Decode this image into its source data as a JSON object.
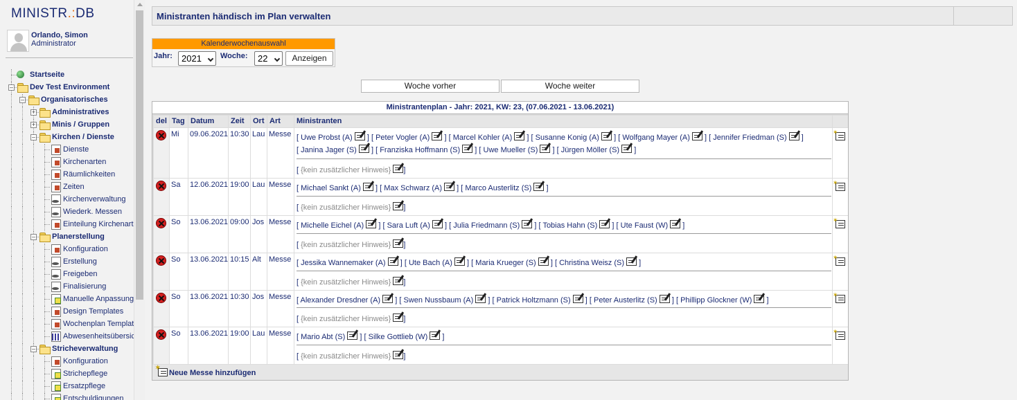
{
  "app": {
    "logo_text": "MINISTR",
    "logo_dot": ".:",
    "logo_suffix": "DB"
  },
  "user": {
    "name": "Orlando, Simon",
    "role": "Administrator"
  },
  "tree": [
    {
      "label": "Startseite",
      "level": 0,
      "icon": "globe-icon",
      "bold": true,
      "expander": ""
    },
    {
      "label": "Dev Test Environment",
      "level": 0,
      "icon": "folder-open-icon",
      "bold": true,
      "expander": "-"
    },
    {
      "label": "Organisatorisches",
      "level": 1,
      "icon": "folder-open-icon",
      "bold": true,
      "expander": "-"
    },
    {
      "label": "Administratives",
      "level": 2,
      "icon": "folder-icon",
      "bold": true,
      "expander": "+"
    },
    {
      "label": "Minis / Gruppen",
      "level": 2,
      "icon": "folder-icon",
      "bold": true,
      "expander": "+"
    },
    {
      "label": "Kirchen / Dienste",
      "level": 2,
      "icon": "folder-open-icon",
      "bold": true,
      "expander": "-"
    },
    {
      "label": "Dienste",
      "level": 3,
      "icon": "settings-page-icon",
      "bold": false,
      "expander": ""
    },
    {
      "label": "Kirchenarten",
      "level": 3,
      "icon": "settings-page-icon",
      "bold": false,
      "expander": ""
    },
    {
      "label": "Räumlichkeiten",
      "level": 3,
      "icon": "settings-page-icon",
      "bold": false,
      "expander": ""
    },
    {
      "label": "Zeiten",
      "level": 3,
      "icon": "settings-page-icon",
      "bold": false,
      "expander": ""
    },
    {
      "label": "Kirchenverwaltung",
      "level": 3,
      "icon": "church-icon",
      "bold": false,
      "expander": ""
    },
    {
      "label": "Wiederk. Messen",
      "level": 3,
      "icon": "church-icon",
      "bold": false,
      "expander": ""
    },
    {
      "label": "Einteilung Kirchenart",
      "level": 3,
      "icon": "people-icon",
      "bold": false,
      "expander": ""
    },
    {
      "label": "Planerstellung",
      "level": 2,
      "icon": "folder-open-icon",
      "bold": true,
      "expander": "-"
    },
    {
      "label": "Konfiguration",
      "level": 3,
      "icon": "settings-page-icon",
      "bold": false,
      "expander": ""
    },
    {
      "label": "Erstellung",
      "level": 3,
      "icon": "disk-icon",
      "bold": false,
      "expander": ""
    },
    {
      "label": "Freigeben",
      "level": 3,
      "icon": "disk-icon",
      "bold": false,
      "expander": ""
    },
    {
      "label": "Finalisierung",
      "level": 3,
      "icon": "disk-icon",
      "bold": false,
      "expander": ""
    },
    {
      "label": "Manuelle Anpassung",
      "level": 3,
      "icon": "edit-tree-icon",
      "bold": false,
      "expander": ""
    },
    {
      "label": "Design Templates",
      "level": 3,
      "icon": "settings-page-icon",
      "bold": false,
      "expander": ""
    },
    {
      "label": "Wochenplan Templat",
      "level": 3,
      "icon": "settings-page-icon",
      "bold": false,
      "expander": ""
    },
    {
      "label": "Abwesenheitsübersic",
      "level": 3,
      "icon": "bar-chart-icon",
      "bold": false,
      "expander": ""
    },
    {
      "label": "Stricheverwaltung",
      "level": 2,
      "icon": "folder-open-icon",
      "bold": true,
      "expander": "-"
    },
    {
      "label": "Konfiguration",
      "level": 3,
      "icon": "settings-page-icon",
      "bold": false,
      "expander": ""
    },
    {
      "label": "Strichepflege",
      "level": 3,
      "icon": "edit-tree-icon",
      "bold": false,
      "expander": ""
    },
    {
      "label": "Ersatzpflege",
      "level": 3,
      "icon": "edit-tree-icon",
      "bold": false,
      "expander": ""
    },
    {
      "label": "Entschuldigungen",
      "level": 3,
      "icon": "edit-tree-icon",
      "bold": false,
      "expander": ""
    }
  ],
  "header": {
    "title": "Ministranten händisch im Plan verwalten"
  },
  "week_select": {
    "title": "Kalenderwochenauswahl",
    "year_label": "Jahr:",
    "year_value": "2021",
    "week_label": "Woche:",
    "week_value": "22",
    "show_button": "Anzeigen"
  },
  "nav": {
    "prev": "Woche vorher",
    "next": "Woche weiter"
  },
  "plan": {
    "title": "Ministrantenplan - Jahr: 2021, KW: 23, (07.06.2021 - 13.06.2021)",
    "columns": [
      "del",
      "Tag",
      "Datum",
      "Zeit",
      "Ort",
      "Art",
      "Ministranten"
    ],
    "hint_text": "{kein zusätzlicher Hinweis}",
    "add_mass": "Neue Messe hinzufügen",
    "rows": [
      {
        "tag": "Mi",
        "datum": "09.06.2021",
        "zeit": "10:30",
        "ort": "Lau",
        "art": "Messe",
        "ministranten": [
          "Uwe Probst (A)",
          "Peter Vogler (A)",
          "Marcel Kohler (A)",
          "Susanne Konig (A)",
          "Wolfgang Mayer (A)",
          "Jennifer Friedman (S)",
          "Janina Jager (S)",
          "Franziska Hoffmann (S)",
          "Uwe Mueller (S)",
          "Jürgen Möller (S)"
        ]
      },
      {
        "tag": "Sa",
        "datum": "12.06.2021",
        "zeit": "19:00",
        "ort": "Lau",
        "art": "Messe",
        "ministranten": [
          "Michael Sankt (A)",
          "Max Schwarz (A)",
          "Marco Austerlitz (S)"
        ]
      },
      {
        "tag": "So",
        "datum": "13.06.2021",
        "zeit": "09:00",
        "ort": "Jos",
        "art": "Messe",
        "ministranten": [
          "Michelle Eichel (A)",
          "Sara Luft (A)",
          "Julia Friedmann (S)",
          "Tobias Hahn (S)",
          "Ute Faust (W)"
        ]
      },
      {
        "tag": "So",
        "datum": "13.06.2021",
        "zeit": "10:15",
        "ort": "Alt",
        "art": "Messe",
        "ministranten": [
          "Jessika Wannemaker (A)",
          "Ute Bach (A)",
          "Maria Krueger (S)",
          "Christina Weisz (S)"
        ]
      },
      {
        "tag": "So",
        "datum": "13.06.2021",
        "zeit": "10:30",
        "ort": "Jos",
        "art": "Messe",
        "ministranten": [
          "Alexander Dresdner (A)",
          "Swen Nussbaum (A)",
          "Patrick Holtzmann (S)",
          "Peter Austerlitz (S)",
          "Phillipp Glockner (W)"
        ]
      },
      {
        "tag": "So",
        "datum": "13.06.2021",
        "zeit": "19:00",
        "ort": "Lau",
        "art": "Messe",
        "ministranten": [
          "Mario Abt (S)",
          "Silke Gottlieb (W)"
        ]
      }
    ]
  }
}
